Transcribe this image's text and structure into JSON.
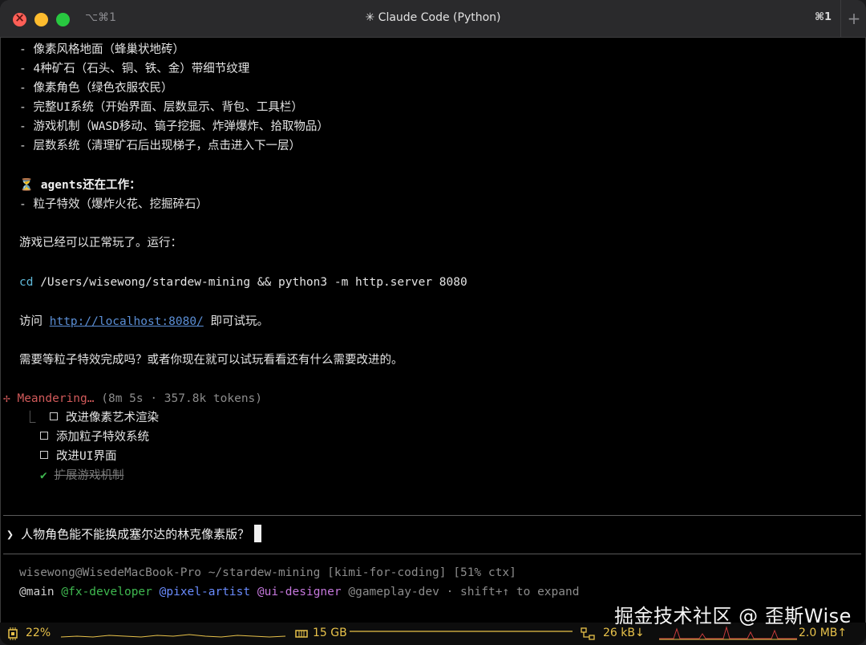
{
  "window": {
    "title": "✳ Claude Code (Python)",
    "shortcut_left": "⌥⌘1",
    "shortcut_right": "⌘1",
    "new_tab": "+"
  },
  "output": {
    "features": [
      "- 像素风格地面（蜂巢状地砖）",
      "- 4种矿石（石头、铜、铁、金）带细节纹理",
      "- 像素角色（绿色衣服农民）",
      "- 完整UI系统（开始界面、层数显示、背包、工具栏）",
      "- 游戏机制（WASD移动、镐子挖掘、炸弹爆炸、拾取物品）",
      "- 层数系统（清理矿石后出现梯子，点击进入下一层）"
    ],
    "agents_heading_icon": "⏳",
    "agents_heading": "agents还在工作：",
    "agents_item": "- 粒子特效（爆炸火花、挖掘碎石）",
    "playable": "游戏已经可以正常玩了。运行：",
    "cmd_keyword": "cd",
    "cmd_rest": " /Users/wisewong/stardew-mining && python3 -m http.server 8080",
    "visit_prefix": "访问 ",
    "visit_link": "http://localhost:8080/",
    "visit_suffix": " 即可试玩。",
    "question": "需要等粒子特效完成吗？或者你现在就可以试玩看看还有什么需要改进的。"
  },
  "task": {
    "spinner": "✢",
    "status": "Meandering…",
    "meta": " (8m 5s · 357.8k tokens)",
    "tree_glyph": "⎿",
    "todos": [
      {
        "label": "改进像素艺术渲染",
        "done": false
      },
      {
        "label": "添加粒子特效系统",
        "done": false
      },
      {
        "label": "改进UI界面",
        "done": false
      },
      {
        "label": "扩展游戏机制",
        "done": true
      }
    ],
    "check_glyph": "✔"
  },
  "input": {
    "prompt_symbol": "❯",
    "value": "人物角色能不能换成塞尔达的林克像素版？"
  },
  "footer": {
    "context": "wisewong@WisedeMacBook-Pro ~/stardew-mining [kimi-for-coding] [51% ctx]",
    "agent_main": "@main",
    "agent_fx": "@fx-developer",
    "agent_pixel": "@pixel-artist",
    "agent_ui": "@ui-designer",
    "agent_gameplay": "@gameplay-dev",
    "expand_hint": " · shift+↑ to expand"
  },
  "statusbar": {
    "cpu": "22%",
    "memory": "15 GB",
    "net_down": "26 kB↓",
    "net_up": "2.0 MB↑"
  },
  "watermark": "掘金技术社区 @ 歪斯Wise",
  "colors": {
    "accent_yellow": "#e8c24a",
    "status_red": "#d15a5a",
    "link_blue": "#5b8fd6",
    "command_cyan": "#5fb8d8",
    "agent_green": "#3fb950",
    "agent_blue": "#6a8cff",
    "agent_purple": "#c678dd"
  }
}
